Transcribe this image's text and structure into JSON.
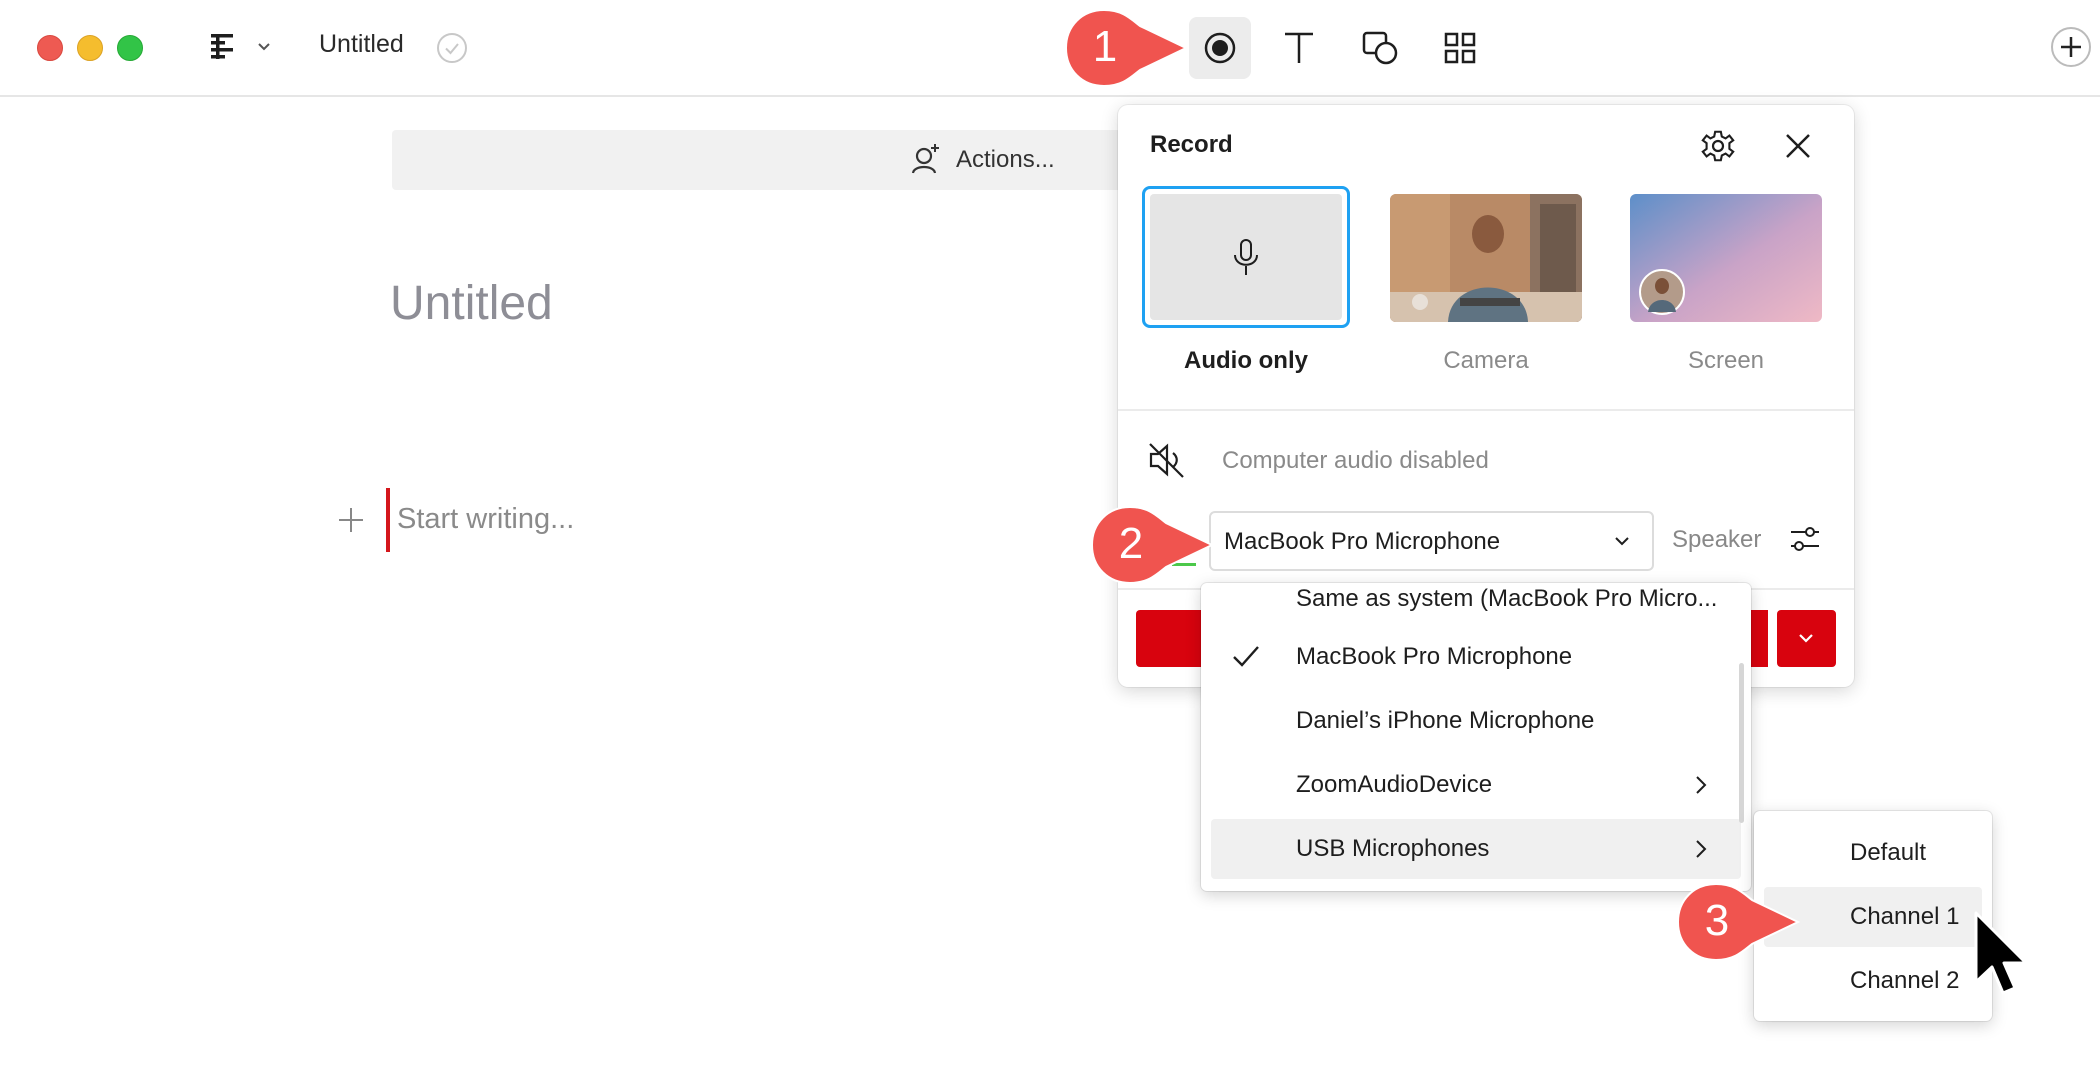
{
  "window": {
    "title": "Untitled",
    "colors": {
      "close": "#ee5a52",
      "minimize": "#f5bd2e",
      "zoom": "#32c447"
    }
  },
  "toolbar": {
    "tools": [
      {
        "icon": "record-icon",
        "active": true
      },
      {
        "icon": "text-icon",
        "active": false
      },
      {
        "icon": "shapes-icon",
        "active": false
      },
      {
        "icon": "grid-icon",
        "active": false
      }
    ],
    "add_icon": "plus-circle-icon",
    "outline_icon": "outline-menu-icon",
    "saved_icon": "check-circle-icon"
  },
  "editor": {
    "actions_label": "Actions...",
    "page_title": "Untitled",
    "placeholder": "Start writing..."
  },
  "record_panel": {
    "title": "Record",
    "options": [
      {
        "label": "Audio only",
        "selected": true
      },
      {
        "label": "Camera",
        "selected": false
      },
      {
        "label": "Screen",
        "selected": false
      }
    ],
    "computer_audio": "Computer audio disabled",
    "microphone_value": "MacBook Pro Microphone",
    "speaker_label": "Speaker",
    "accent_color": "#d8030e",
    "selection_color": "#1ea1f2"
  },
  "mic_menu": {
    "items": [
      {
        "label": "Same as system (MacBook Pro Micro...",
        "checked": false,
        "submenu": false
      },
      {
        "label": "MacBook Pro Microphone",
        "checked": true,
        "submenu": false
      },
      {
        "label": "Daniel’s iPhone Microphone",
        "checked": false,
        "submenu": false
      },
      {
        "label": "ZoomAudioDevice",
        "checked": false,
        "submenu": true
      },
      {
        "label": "USB Microphones",
        "checked": false,
        "submenu": true,
        "highlighted": true
      }
    ]
  },
  "channel_menu": {
    "items": [
      {
        "label": "Default",
        "highlighted": false
      },
      {
        "label": "Channel 1",
        "highlighted": true
      },
      {
        "label": "Channel 2",
        "highlighted": false
      }
    ]
  },
  "callouts": [
    {
      "number": "1"
    },
    {
      "number": "2"
    },
    {
      "number": "3"
    }
  ],
  "callout_color": "#f0544f"
}
